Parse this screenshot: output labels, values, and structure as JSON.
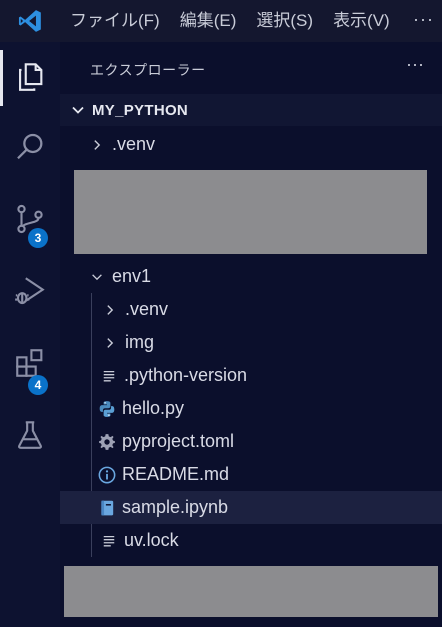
{
  "menu": {
    "file": "ファイル(F)",
    "edit": "編集(E)",
    "selection": "選択(S)",
    "view": "表示(V)",
    "more": "···"
  },
  "activity_bar": {
    "source_control_badge": "3",
    "extensions_badge": "4"
  },
  "explorer": {
    "title": "エクスプローラー",
    "more": "···",
    "folder_name": "MY_PYTHON",
    "tree": [
      {
        "label": ".venv",
        "icon": "chevron-right-icon"
      },
      {
        "label": "env1",
        "icon": "chevron-down-icon"
      },
      {
        "label": ".venv",
        "icon": "chevron-right-icon"
      },
      {
        "label": "img",
        "icon": "chevron-right-icon"
      },
      {
        "label": ".python-version",
        "icon": "lines-icon"
      },
      {
        "label": "hello.py",
        "icon": "python-icon"
      },
      {
        "label": "pyproject.toml",
        "icon": "gear-icon"
      },
      {
        "label": "README.md",
        "icon": "info-icon"
      },
      {
        "label": "sample.ipynb",
        "icon": "notebook-icon"
      },
      {
        "label": "uv.lock",
        "icon": "lines-icon"
      }
    ]
  },
  "colors": {
    "accent": "#0a72c9",
    "background": "#0b0f2c",
    "selected_row": "#1c2140"
  }
}
